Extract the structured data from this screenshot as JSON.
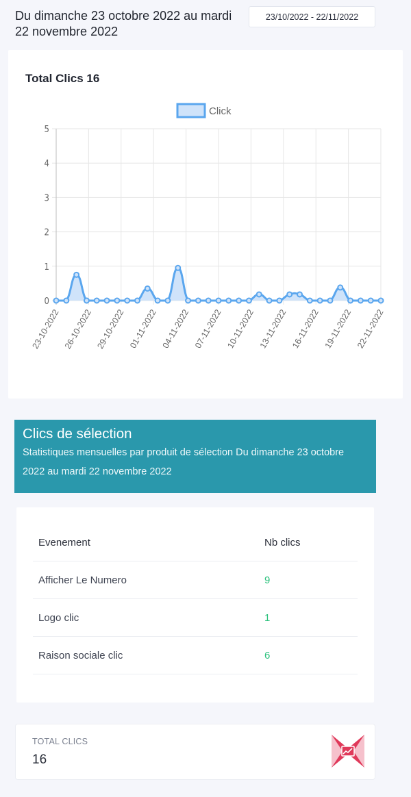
{
  "header": {
    "title": "Du dimanche 23 octobre 2022 au mardi 22 novembre 2022",
    "date_range": "23/10/2022 - 22/11/2022"
  },
  "chart_card": {
    "title": "Total Clics 16"
  },
  "chart_data": {
    "type": "area",
    "series": [
      {
        "name": "Click",
        "values": [
          0,
          0,
          0.75,
          0,
          0,
          0,
          0,
          0,
          0,
          0.35,
          0,
          0,
          0.95,
          0,
          0,
          0,
          0,
          0,
          0,
          0,
          0.18,
          0,
          0,
          0.18,
          0.18,
          0,
          0,
          0,
          0.38,
          0,
          0,
          0,
          0
        ]
      }
    ],
    "x": [
      "23-10-2022",
      "24-10-2022",
      "25-10-2022",
      "26-10-2022",
      "27-10-2022",
      "28-10-2022",
      "29-10-2022",
      "30-10-2022",
      "31-10-2022",
      "01-11-2022",
      "02-11-2022",
      "03-11-2022",
      "04-11-2022",
      "05-11-2022",
      "06-11-2022",
      "07-11-2022",
      "08-11-2022",
      "09-11-2022",
      "10-11-2022",
      "11-11-2022",
      "12-11-2022",
      "13-11-2022",
      "14-11-2022",
      "15-11-2022",
      "16-11-2022",
      "17-11-2022",
      "18-11-2022",
      "19-11-2022",
      "20-11-2022",
      "21-11-2022",
      "22-11-2022"
    ],
    "x_tick_labels": [
      "23-10-2022",
      "26-10-2022",
      "29-10-2022",
      "01-11-2022",
      "04-11-2022",
      "07-11-2022",
      "10-11-2022",
      "13-11-2022",
      "16-11-2022",
      "19-11-2022",
      "22-11-2022"
    ],
    "y_tick_labels": [
      "0",
      "1",
      "2",
      "3",
      "4",
      "5"
    ],
    "ylim": [
      0,
      5
    ],
    "grid": true,
    "legend": "top-center",
    "line_color": "#5aa6ee",
    "fill_color": "#cfe3fa"
  },
  "selection": {
    "title": "Clics de sélection",
    "subtitle": "Statistiques mensuelles par produit de sélection Du dimanche 23 octobre 2022 au mardi 22 novembre 2022"
  },
  "table": {
    "headers": [
      "Evenement",
      "Nb clics"
    ],
    "rows": [
      {
        "event": "Afficher Le Numero",
        "clicks": "9"
      },
      {
        "event": "Logo clic",
        "clicks": "1"
      },
      {
        "event": "Raison sociale clic",
        "clicks": "6"
      }
    ]
  },
  "total": {
    "label": "TOTAL CLICS",
    "value": "16",
    "icon": "chart-logo-icon"
  },
  "colors": {
    "banner": "#2a98ac",
    "number_green": "#2ec27e",
    "icon_red": "#e0395a"
  }
}
